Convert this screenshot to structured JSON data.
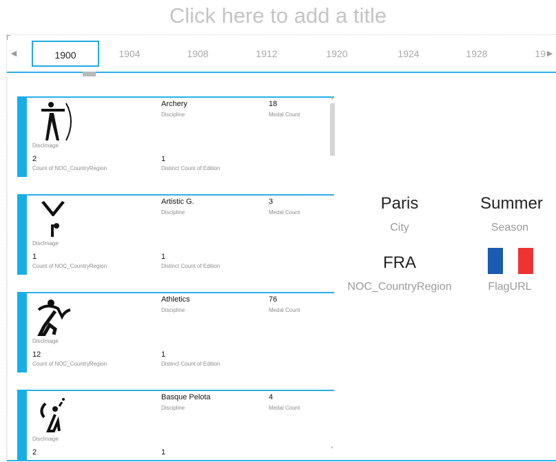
{
  "title": "Click here to add a title",
  "timeline": {
    "left_arrow": "◀",
    "right_arrow": "▶",
    "years": [
      "1900",
      "1904",
      "1908",
      "1912",
      "1920",
      "1924",
      "1928",
      "19"
    ],
    "selected": "1900"
  },
  "labels": {
    "disc_image": "DiscImage",
    "count_noc": "Count of NOC_CountryRegion",
    "distinct_edition": "Distinct Count of Edition",
    "discipline": "Discipline",
    "medal_count": "Medal Count"
  },
  "sports": [
    {
      "discipline": "Archery",
      "medals": "18",
      "noc_count": "2",
      "editions": "1",
      "icon": "archery-icon"
    },
    {
      "discipline": "Artistic G.",
      "medals": "3",
      "noc_count": "1",
      "editions": "1",
      "icon": "gymnastics-icon"
    },
    {
      "discipline": "Athletics",
      "medals": "76",
      "noc_count": "12",
      "editions": "1",
      "icon": "athletics-icon"
    },
    {
      "discipline": "Basque Pelota",
      "medals": "4",
      "noc_count": "2",
      "editions": "1",
      "icon": "pelota-icon"
    }
  ],
  "host": {
    "city": "Paris",
    "city_label": "City",
    "season": "Summer",
    "season_label": "Season",
    "noc": "FRA",
    "noc_label": "NOC_CountryRegion",
    "flag_label": "FlagURL",
    "flag_colors": [
      "#0055a4",
      "#ffffff",
      "#ef4135"
    ]
  },
  "colors": {
    "accent": "#29aee8"
  }
}
